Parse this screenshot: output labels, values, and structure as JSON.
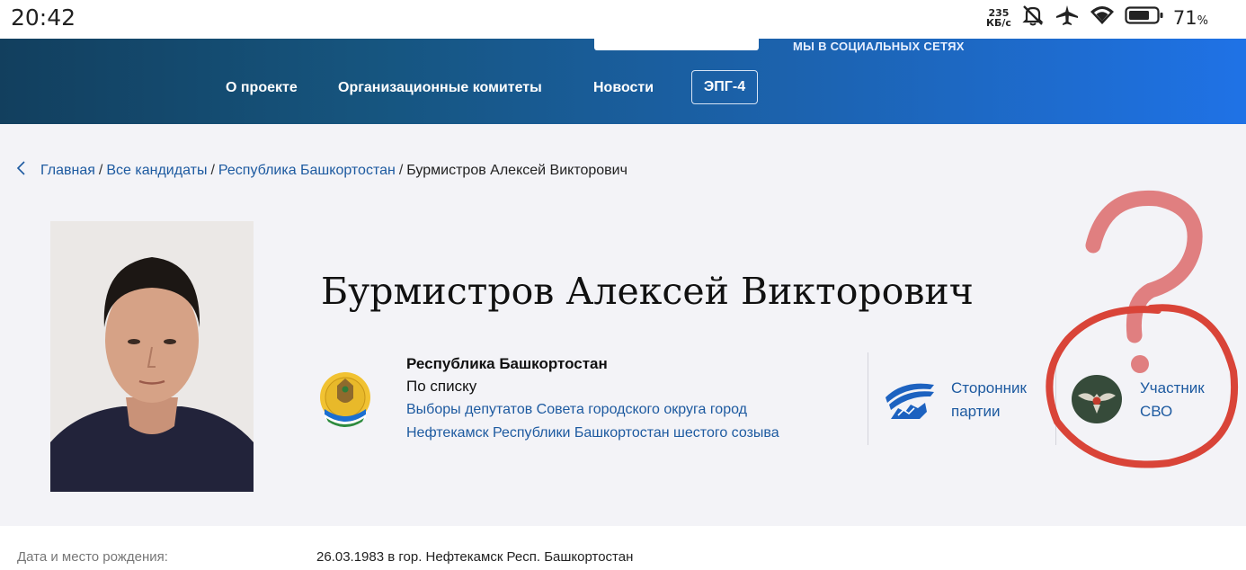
{
  "status_bar": {
    "time": "20:42",
    "net_speed_value": "235",
    "net_speed_unit": "КБ/с",
    "battery_percent": "71",
    "battery_unit": "%"
  },
  "header": {
    "social_label": "МЫ В СОЦИАЛЬНЫХ СЕТЯХ",
    "nav": {
      "about": "О проекте",
      "committees": "Организационные комитеты",
      "news": "Новости",
      "epg": "ЭПГ-4"
    }
  },
  "breadcrumb": {
    "home": "Главная",
    "all_candidates": "Все кандидаты",
    "region": "Республика Башкортостан",
    "current": "Бурмистров Алексей Викторович",
    "separator": "/"
  },
  "candidate": {
    "name": "Бурмистров Алексей Викторович",
    "region": "Республика Башкортостан",
    "list_type": "По списку",
    "election_line1": "Выборы депутатов Совета городского округа город",
    "election_line2": "Нефтекамск Республики Башкортостан шестого созыва",
    "party_status_line1": "Сторонник",
    "party_status_line2": "партии",
    "svo_line1": "Участник",
    "svo_line2": "СВО"
  },
  "info": {
    "birth_label": "Дата и место рождения:",
    "birth_value": "26.03.1983 в гор. Нефтекамск Респ. Башкортостан"
  },
  "colors": {
    "link": "#1d5aa0",
    "header_start": "#123f5e",
    "header_end": "#1f72e6",
    "annotation_red": "#d94438",
    "annotation_pink": "#e07f80"
  }
}
